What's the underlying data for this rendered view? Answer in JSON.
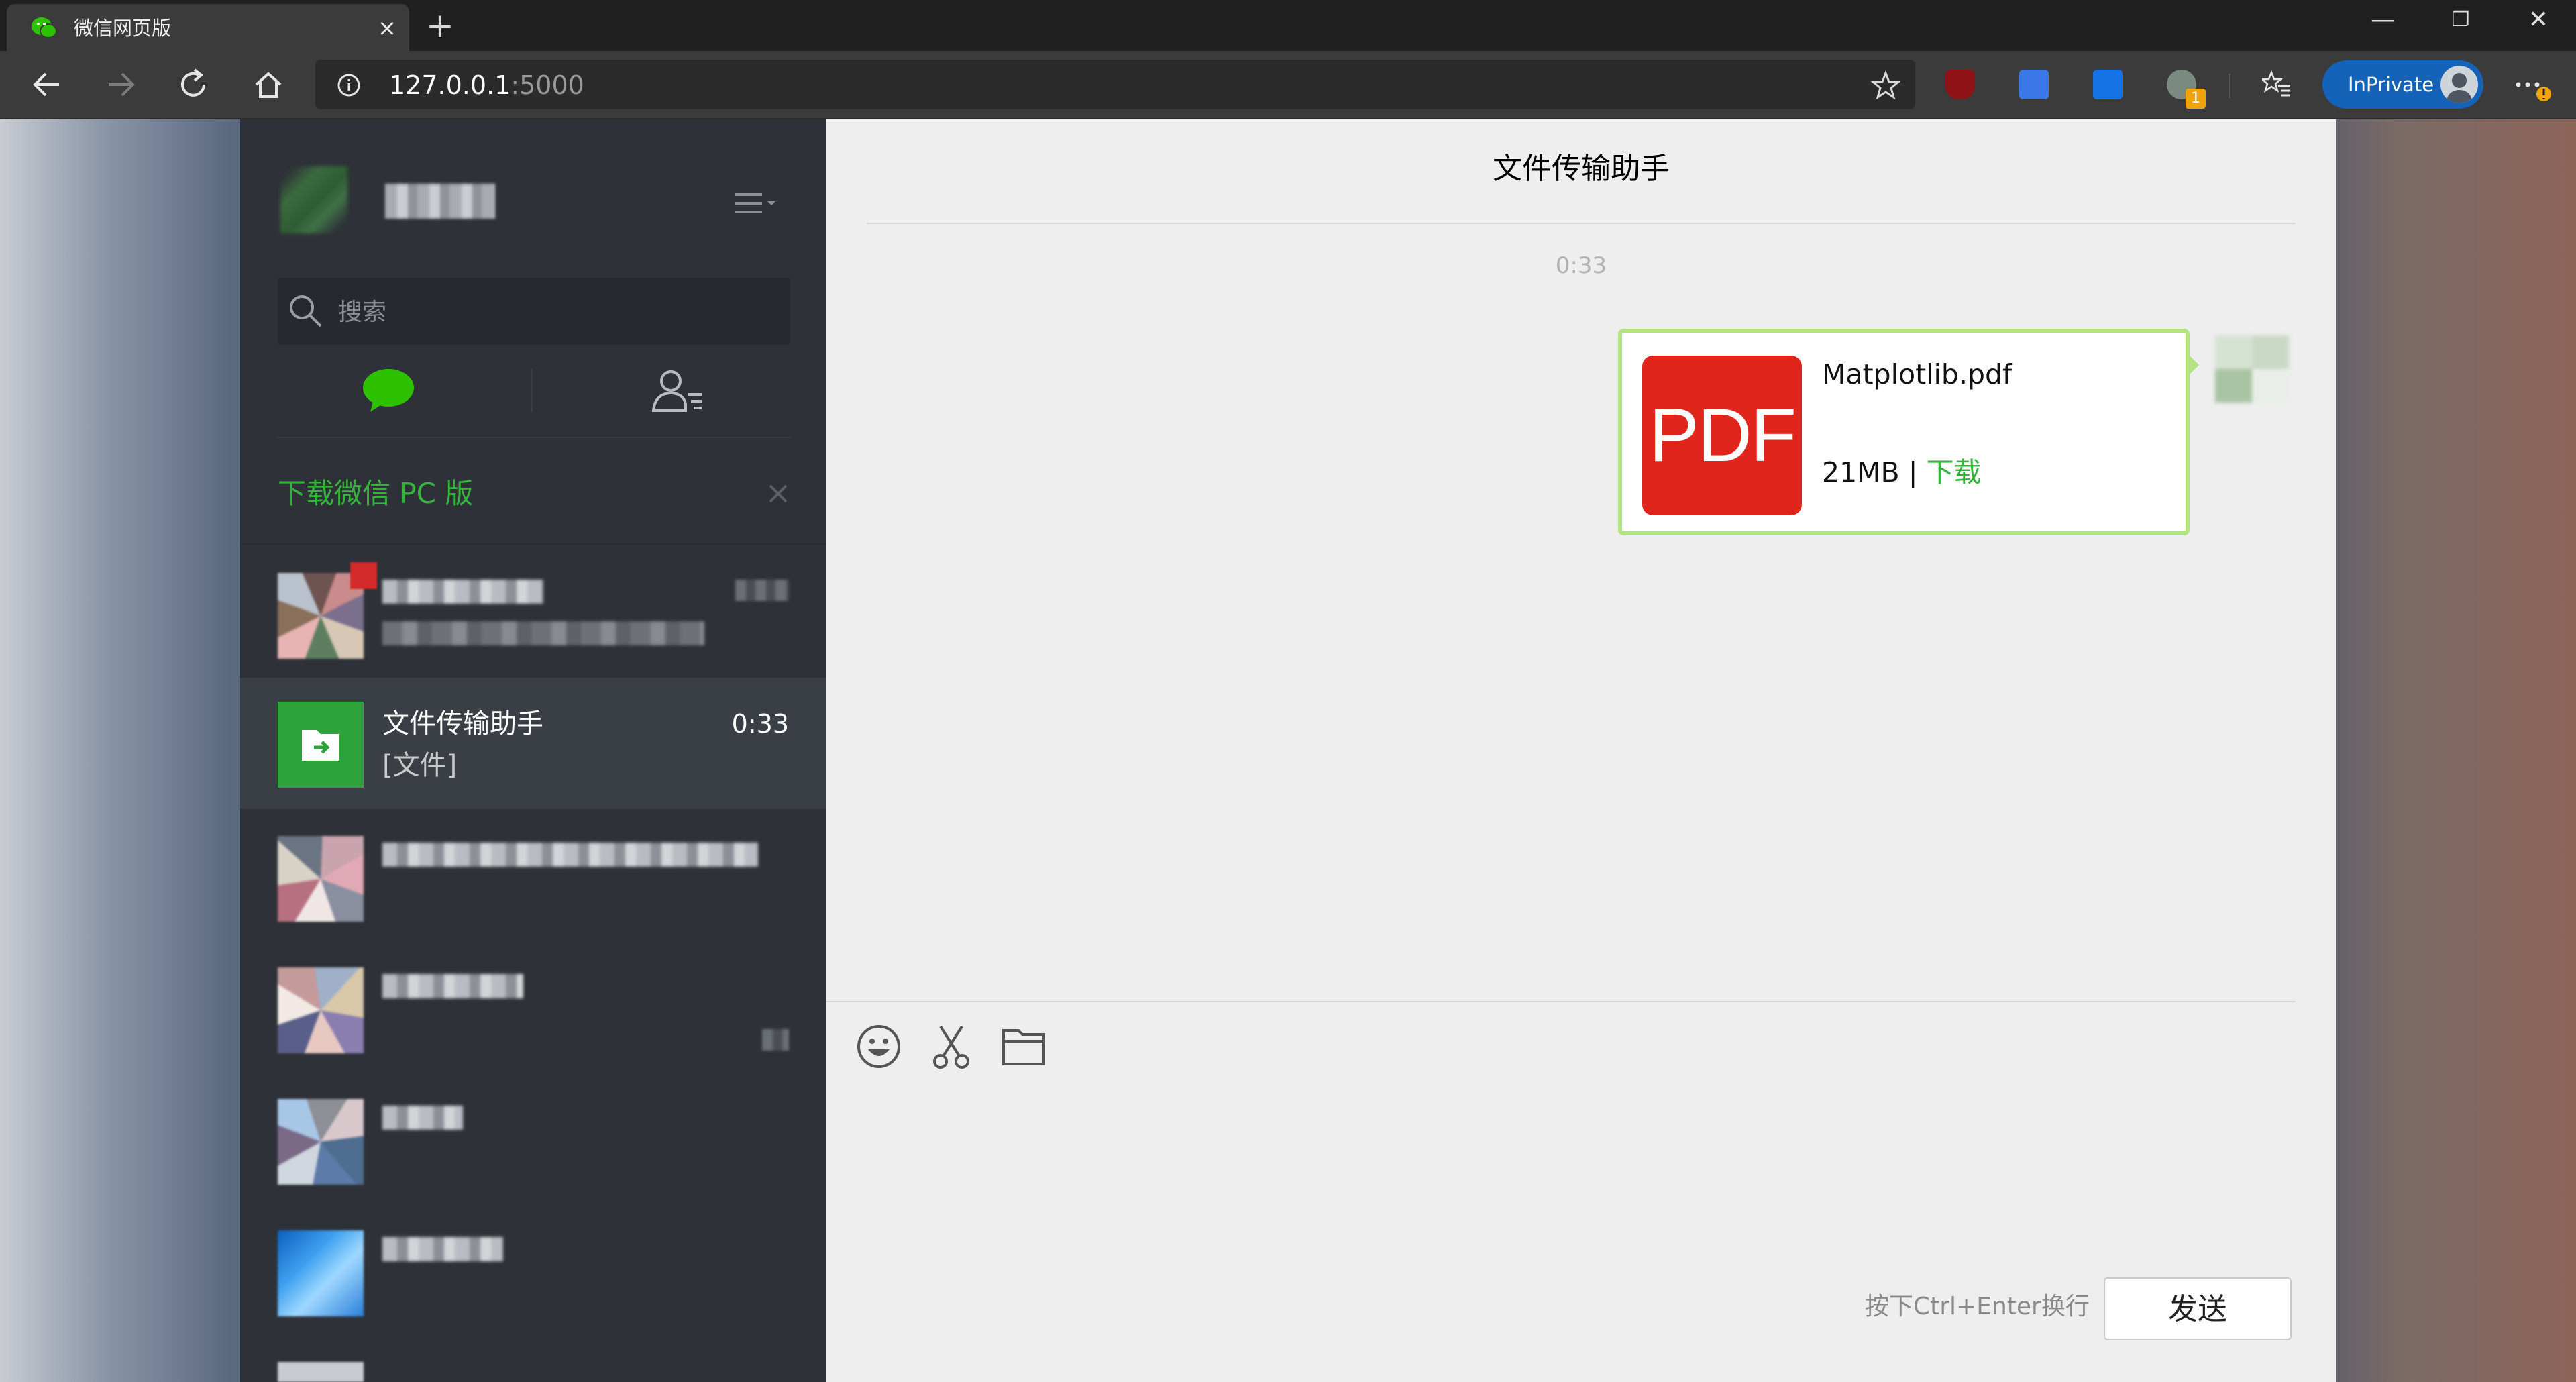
{
  "browser": {
    "tab_title": "微信网页版",
    "tab_close": "×",
    "new_tab": "+",
    "address_host": "127.0.0.1",
    "address_port": ":5000",
    "inprivate_label": "InPrivate",
    "window_controls": {
      "minimize": "—",
      "restore": "❐",
      "close": "✕"
    },
    "extension_badge": "1"
  },
  "sidebar": {
    "search_placeholder": "搜索",
    "download_banner": "下载微信 PC 版",
    "chats": [
      {
        "name": "文件传输助手",
        "preview": "[文件]",
        "time": "0:33"
      }
    ]
  },
  "chat": {
    "title": "文件传输助手",
    "message_time": "0:33",
    "file": {
      "icon_label": "PDF",
      "name": "Matplotlib.pdf",
      "size": "21MB",
      "separator": " | ",
      "download_label": "下载"
    },
    "hint": "按下Ctrl+Enter换行",
    "send_label": "发送"
  },
  "colors": {
    "wechat_green": "#35b43d",
    "sidebar_bg": "#2e3238",
    "pdf_red": "#e0261c",
    "bubble_border": "#b2e281",
    "inprivate_blue": "#1463b8"
  }
}
